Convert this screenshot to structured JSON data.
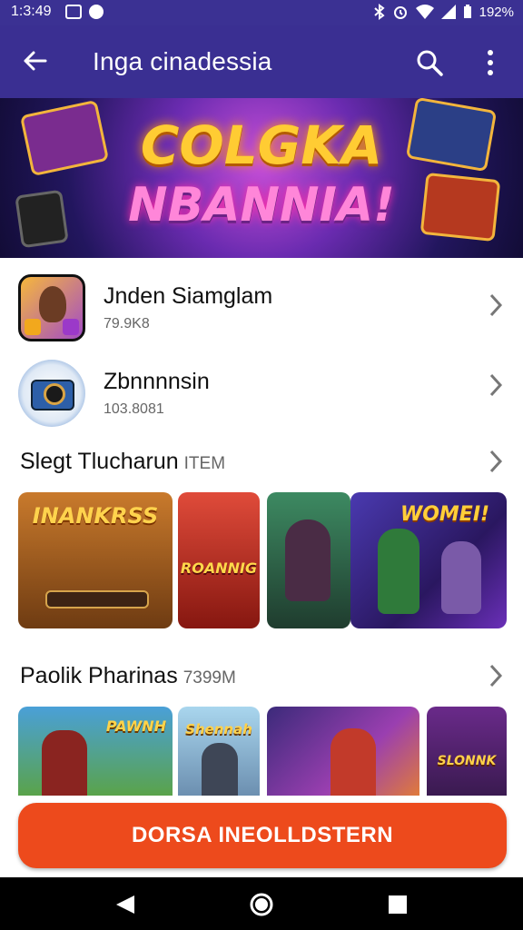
{
  "status_bar": {
    "time": "1:3:49",
    "battery": "192%"
  },
  "app_bar": {
    "title": "Inga cinadessia",
    "back_icon": "arrow-left-icon",
    "search_icon": "search-icon",
    "more_icon": "more-vert-icon"
  },
  "banner": {
    "line1": "COLGKA",
    "line2": "NBANNIA!"
  },
  "apps": [
    {
      "name": "Jnden Siamglam",
      "sub": "79.9K8"
    },
    {
      "name": "Zbnnnnsin",
      "sub": "103.8081"
    }
  ],
  "sections": [
    {
      "title": "Slegt Tlucharun",
      "tag": "ITEM",
      "cards": [
        "INANKRSS",
        "ROANNIG",
        "",
        "WOMEI!"
      ]
    },
    {
      "title": "Paolik Pharinas",
      "tag": "7399M",
      "cards": [
        "PAWNH",
        "Shennah",
        "",
        "SLONNK"
      ]
    }
  ],
  "cta": {
    "label": "DORSA INEOLLDSTERN"
  },
  "colors": {
    "app_bar": "#3a2f92",
    "cta": "#ed4a1c"
  }
}
